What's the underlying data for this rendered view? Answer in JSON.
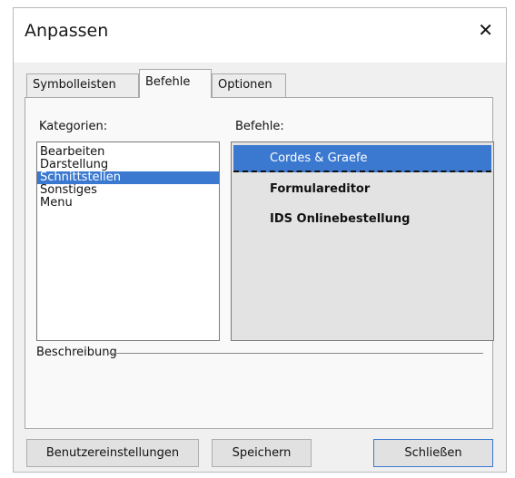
{
  "window": {
    "title": "Anpassen",
    "close_glyph": "✕"
  },
  "tabs": [
    {
      "label": "Symbolleisten"
    },
    {
      "label": "Befehle"
    },
    {
      "label": "Optionen"
    }
  ],
  "active_tab": "Befehle",
  "categories": {
    "label": "Kategorien:",
    "items": [
      "Bearbeiten",
      "Darstellung",
      "Schnittstellen",
      "Sonstiges",
      "Menu"
    ],
    "selected": "Schnittstellen"
  },
  "commands": {
    "label": "Befehle:",
    "items": [
      "Cordes & Graefe",
      "Formulareditor",
      "IDS Onlinebestellung"
    ],
    "selected": "Cordes & Graefe"
  },
  "description": {
    "label": "Beschreibung"
  },
  "buttons": {
    "user_settings": "Benutzereinstellungen",
    "save": "Speichern",
    "close": "Schließen"
  },
  "colors": {
    "selection": "#3b79d0",
    "window_bg": "#f0f0f0"
  }
}
